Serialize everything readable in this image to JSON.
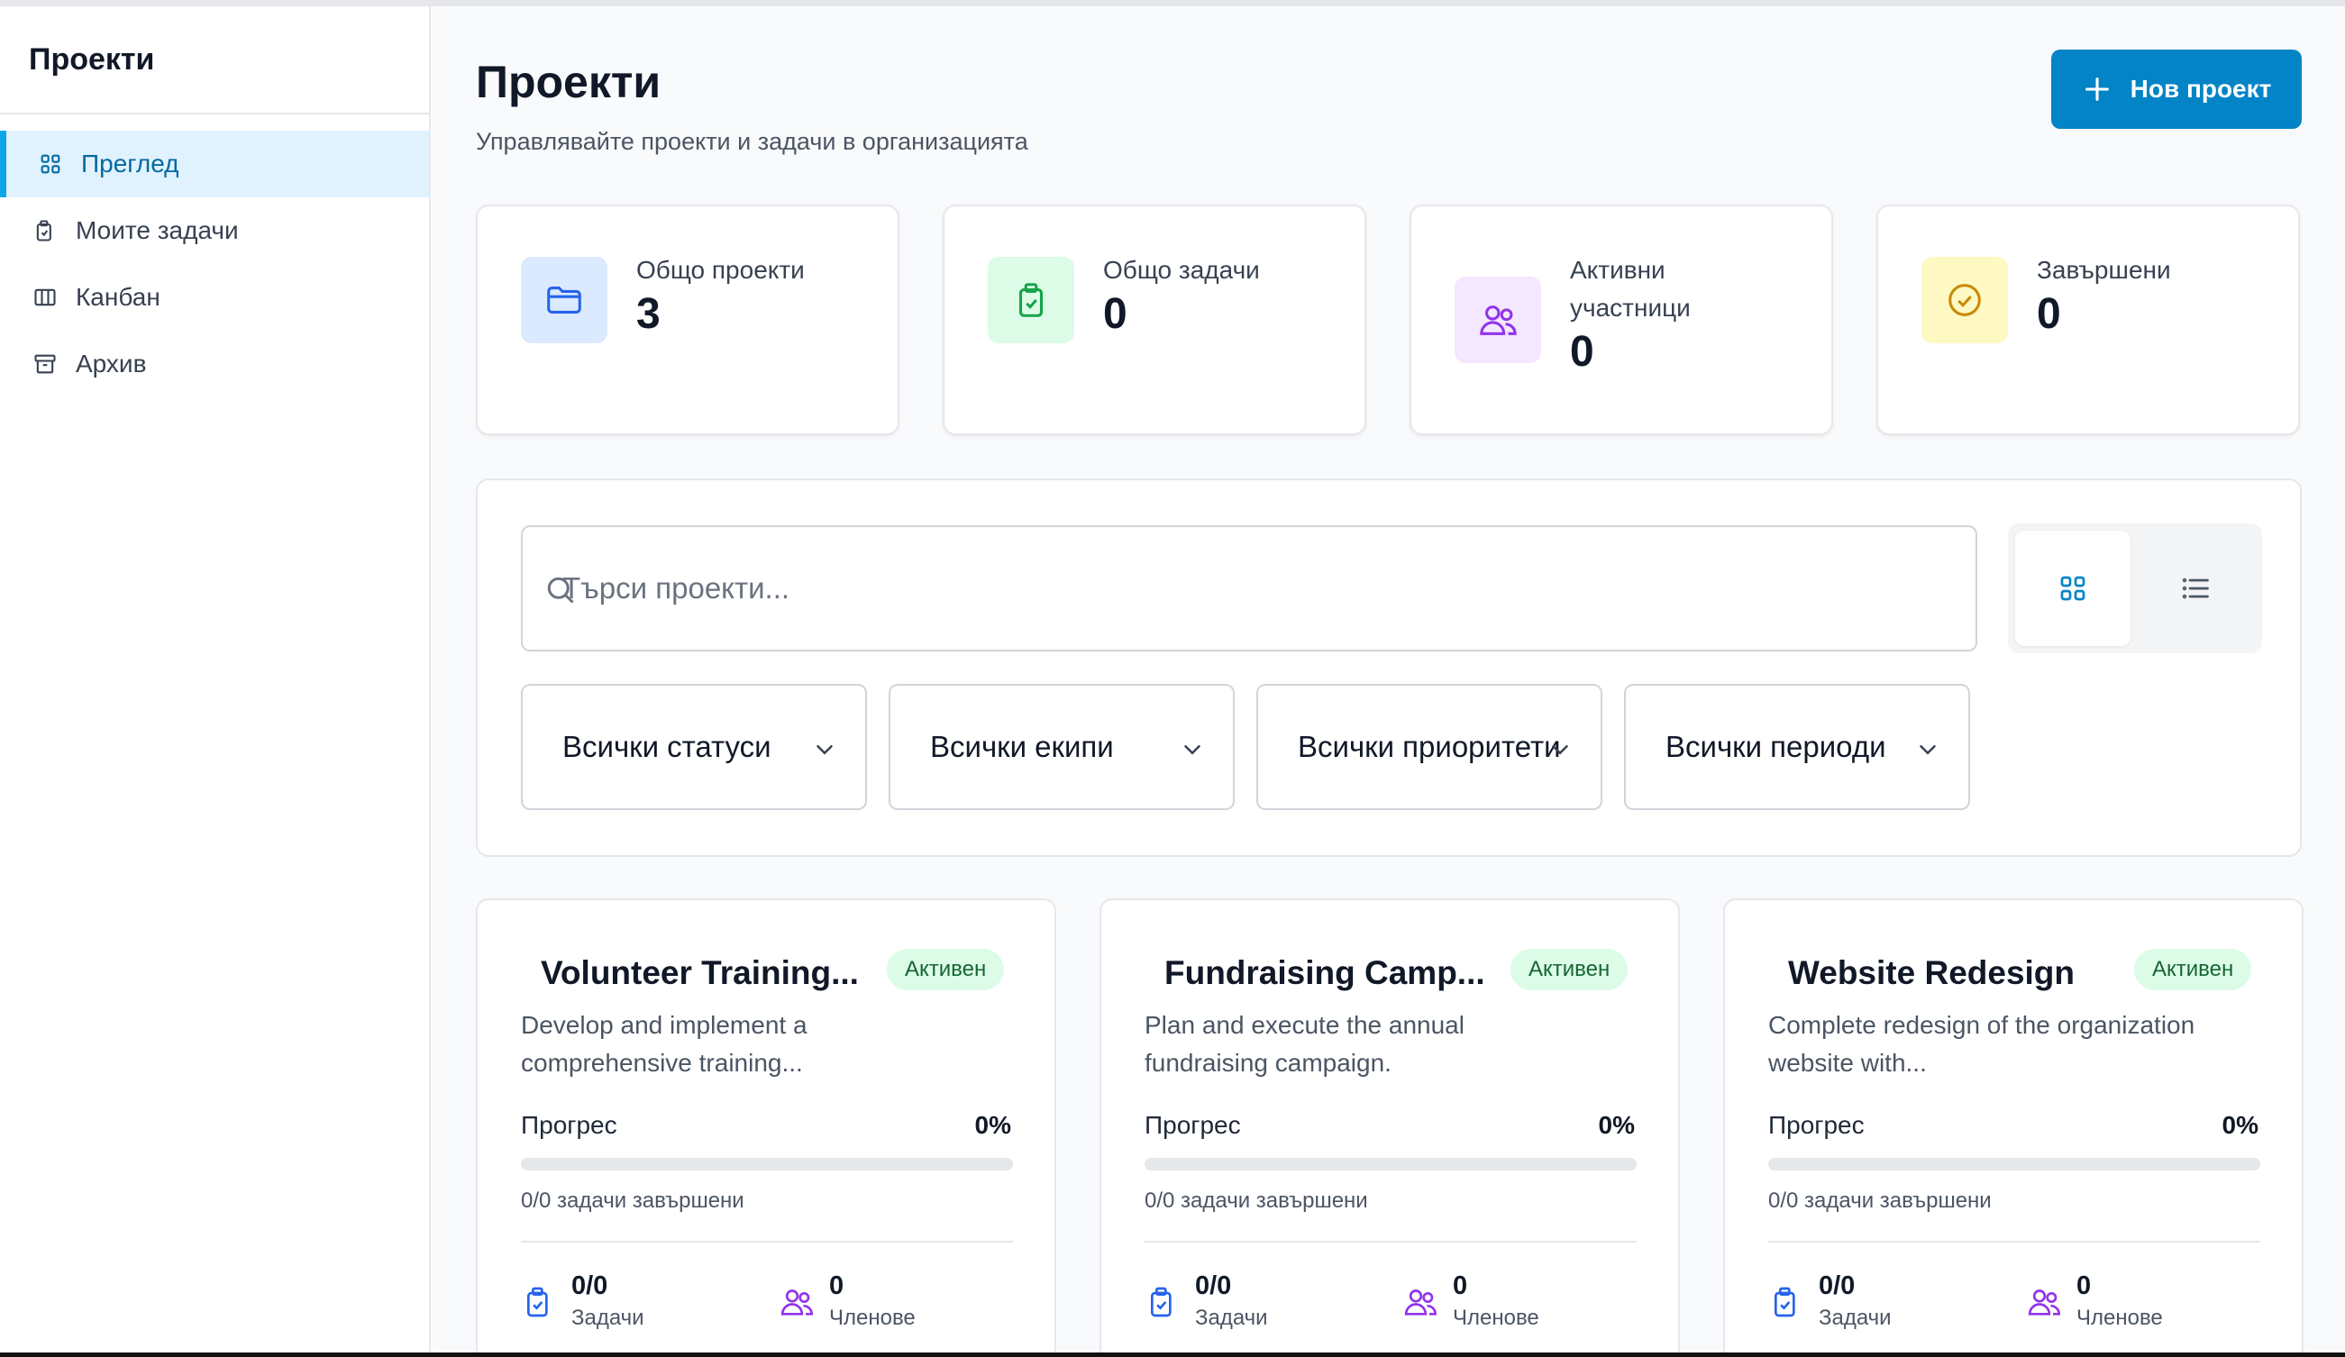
{
  "sidebar": {
    "title": "Проекти",
    "items": [
      {
        "label": "Преглед",
        "icon": "grid-icon",
        "active": true
      },
      {
        "label": "Моите задачи",
        "icon": "clipboard-icon",
        "active": false
      },
      {
        "label": "Канбан",
        "icon": "columns-icon",
        "active": false
      },
      {
        "label": "Архив",
        "icon": "archive-icon",
        "active": false
      }
    ]
  },
  "header": {
    "title": "Проекти",
    "subtitle": "Управлявайте проекти и задачи в организацията",
    "new_button": "Нов проект"
  },
  "stats": [
    {
      "label": "Общо проекти",
      "value": "3",
      "icon": "folder-icon",
      "bg": "#dbeafe",
      "color": "#2563eb"
    },
    {
      "label": "Общо задачи",
      "value": "0",
      "icon": "clipboard-check-icon",
      "bg": "#dcfce7",
      "color": "#16a34a"
    },
    {
      "label": "Активни участници",
      "value": "0",
      "icon": "users-icon",
      "bg": "#f3e8ff",
      "color": "#9333ea"
    },
    {
      "label": "Завършени",
      "value": "0",
      "icon": "check-circle-icon",
      "bg": "#fef9c3",
      "color": "#ca8a04"
    }
  ],
  "filters": {
    "search_placeholder": "Търси проекти...",
    "selects": [
      "Всички статуси",
      "Всички екипи",
      "Всички приоритети",
      "Всички периоди"
    ],
    "view_modes": [
      "grid-icon",
      "list-icon"
    ]
  },
  "projects": [
    {
      "title": "Volunteer Training...",
      "status": "Активен",
      "description": "Develop and implement a comprehensive training...",
      "progress_label": "Прогрес",
      "progress": "0%",
      "tasks_done": "0/0 задачи завършени",
      "tasks_value": "0/0",
      "tasks_label": "Задачи",
      "members_value": "0",
      "members_label": "Членове"
    },
    {
      "title": "Fundraising Camp...",
      "status": "Активен",
      "description": "Plan and execute the annual fundraising campaign.",
      "progress_label": "Прогрес",
      "progress": "0%",
      "tasks_done": "0/0 задачи завършени",
      "tasks_value": "0/0",
      "tasks_label": "Задачи",
      "members_value": "0",
      "members_label": "Членове"
    },
    {
      "title": "Website Redesign",
      "status": "Активен",
      "description": "Complete redesign of the organization website with...",
      "progress_label": "Прогрес",
      "progress": "0%",
      "tasks_done": "0/0 задачи завършени",
      "tasks_value": "0/0",
      "tasks_label": "Задачи",
      "members_value": "0",
      "members_label": "Членове"
    }
  ],
  "colors": {
    "accent": "#0284c7",
    "active_nav_bg": "#e0f2fe",
    "badge_bg": "#dcfce7",
    "badge_text": "#166534",
    "task_icon": "#2563eb",
    "member_icon": "#9333ea"
  }
}
